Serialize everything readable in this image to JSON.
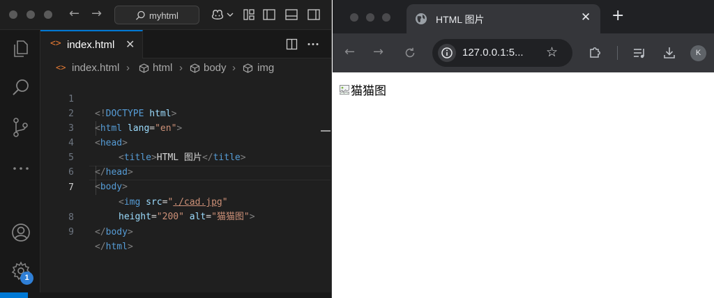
{
  "vscode": {
    "command_center": "myhtml",
    "tab": {
      "label": "index.html",
      "icon": "<>"
    },
    "breadcrumb": [
      "index.html",
      "html",
      "body",
      "img"
    ],
    "badge_count": "1",
    "lines": [
      {
        "n": "1",
        "active": false
      },
      {
        "n": "2",
        "active": false
      },
      {
        "n": "3",
        "active": false
      },
      {
        "n": "4",
        "active": false
      },
      {
        "n": "5",
        "active": false
      },
      {
        "n": "6",
        "active": false
      },
      {
        "n": "7",
        "active": true
      },
      {
        "n": "",
        "active": false
      },
      {
        "n": "8",
        "active": false
      },
      {
        "n": "9",
        "active": false
      }
    ],
    "code": {
      "l1": {
        "open": "<!",
        "kw": "DOCTYPE",
        "sp": " ",
        "name": "html",
        "close": ">"
      },
      "l2": {
        "open": "<",
        "tag": "html",
        "sp": " ",
        "attr": "lang",
        "eq": "=",
        "val": "\"en\"",
        "close": ">"
      },
      "l3": {
        "open": "<",
        "tag": "head",
        "close": ">"
      },
      "l4": {
        "open": "<",
        "tag": "title",
        "close": ">",
        "text": "HTML 图片",
        "open2": "</",
        "tag2": "title",
        "close2": ">"
      },
      "l5": {
        "open": "</",
        "tag": "head",
        "close": ">"
      },
      "l6": {
        "open": "<",
        "tag": "body",
        "close": ">"
      },
      "l7": {
        "open": "<",
        "tag": "img",
        "sp": " ",
        "attr": "src",
        "eq": "=",
        "q1": "\"",
        "link": "./cad.jpg",
        "q2": "\""
      },
      "l7b": {
        "attr": "height",
        "eq": "=",
        "val": "\"200\"",
        "sp": " ",
        "attr2": "alt",
        "eq2": "=",
        "val2": "\"猫猫图\"",
        "close": ">"
      },
      "l8": {
        "open": "</",
        "tag": "body",
        "close": ">"
      },
      "l9": {
        "open": "</",
        "tag": "html",
        "close": ">"
      }
    }
  },
  "chrome": {
    "tab_title": "HTML 图片",
    "url": "127.0.0.1:5...",
    "avatar_initial": "K",
    "page": {
      "img_alt": "猫猫图"
    }
  },
  "colors": {
    "vscode_bg": "#1f1f1f",
    "accent": "#0078d4",
    "tag": "#569cd6",
    "attr": "#9cdcfe",
    "string": "#ce9178",
    "chrome_dark": "#202124"
  },
  "icons": {
    "activity_bar": [
      "files-icon",
      "search-icon",
      "source-control-icon",
      "more-icon",
      "account-icon",
      "gear-icon"
    ]
  }
}
